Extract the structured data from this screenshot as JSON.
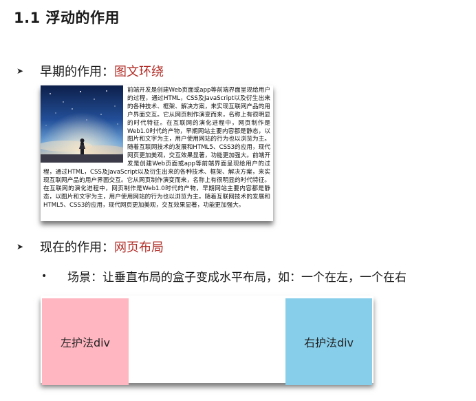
{
  "heading": "1.1 浮动的作用",
  "section_early": {
    "prefix": "早期的作用：",
    "highlight": "图文环绕"
  },
  "wrap_paragraph": "前端开发是创建Web页面或app等前端界面呈现给用户的过程，通过HTML，CSS及JavaScript以及衍生出来的各种技术、框架、解决方案，来实现互联网产品的用户界面交互。它从网页制作演变而来，名称上有很明显的时代特征。在互联网的演化进程中，网页制作是Web1.0时代的产物，早期网站主要内容都是静态，以图片和文字为主，用户使用网站的行为也以浏览为主。随着互联网技术的发展和HTML5、CSS3的应用，现代网页更加美观，交互效果显著，功能更加强大。前端开发是创建Web页面或app等前端界面呈现给用户的过程，通过HTML，CSS及JavaScript以及衍生出来的各种技术、框架、解决方案，来实现互联网产品的用户界面交互。它从网页制作演变而来，名称上有很明显的时代特征。在互联网的演化进程中，网页制作是Web1.0时代的产物，早期网站主要内容都是静态，以图片和文字为主，用户使用网站的行为也以浏览为主。随着互联网技术的发展和HTML5、CSS3的应用，现代网页更加美观，交互效果显著，功能更加强大。",
  "section_now": {
    "prefix": "现在的作用：",
    "highlight": "网页布局"
  },
  "scenario": "场景：让垂直布局的盒子变成水平布局，如：一个在左，一个在右",
  "left_box": {
    "label": "左护法div",
    "color": "#ffb6c1"
  },
  "right_box": {
    "label": "右护法div",
    "color": "#87ceeb"
  },
  "colors": {
    "accent": "#b22d27"
  },
  "icons": {
    "bullet": "triangle-right-icon",
    "sub_bullet": "dot-icon",
    "image": "starry-sky-girl-image"
  }
}
